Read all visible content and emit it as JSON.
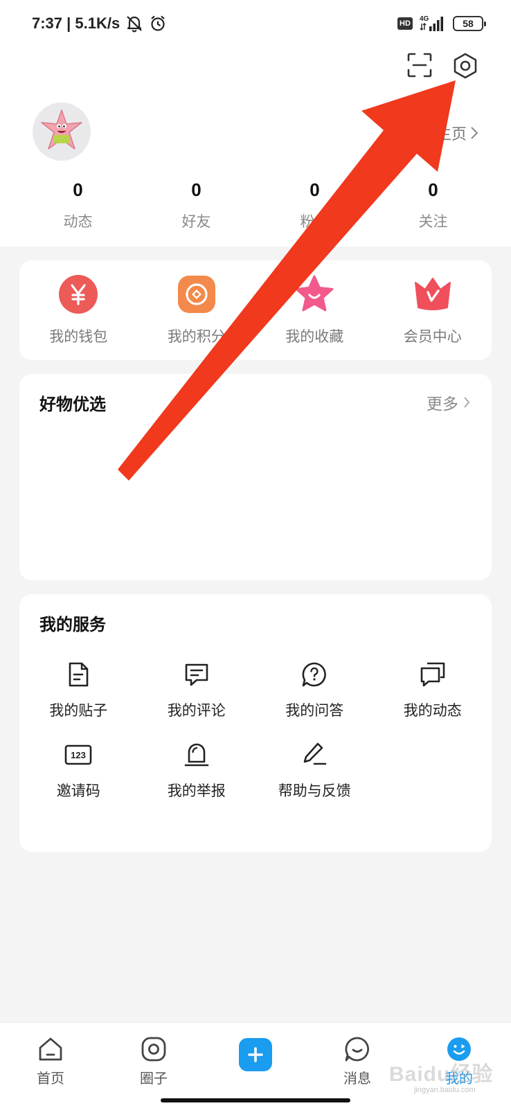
{
  "status_bar": {
    "time_speed": "7:37 | 5.1K/s",
    "hd": "HD",
    "network": "4G",
    "battery": "58",
    "icons": [
      "mute-bell-icon",
      "alarm-icon",
      "signal-icon"
    ]
  },
  "header": {
    "scan_icon": "scan-icon",
    "settings_icon": "settings-hexagon-icon"
  },
  "profile": {
    "homepage_link": "主页",
    "avatar": "patrick-star-avatar",
    "stats": [
      {
        "value": "0",
        "label": "动态"
      },
      {
        "value": "0",
        "label": "好友"
      },
      {
        "value": "0",
        "label": "粉丝"
      },
      {
        "value": "0",
        "label": "关注"
      }
    ]
  },
  "quick_actions": [
    {
      "label": "我的钱包",
      "icon": "wallet-yen-icon",
      "color": "#ec5b57"
    },
    {
      "label": "我的积分",
      "icon": "points-coin-icon",
      "color": "#f3894a"
    },
    {
      "label": "我的收藏",
      "icon": "favorite-star-icon",
      "color": "#f25a8b"
    },
    {
      "label": "会员中心",
      "icon": "vip-crown-icon",
      "color": "#f04f5c"
    }
  ],
  "goods": {
    "title": "好物优选",
    "more": "更多"
  },
  "services": {
    "title": "我的服务",
    "items": [
      {
        "label": "我的贴子",
        "icon": "document-icon"
      },
      {
        "label": "我的评论",
        "icon": "comment-icon"
      },
      {
        "label": "我的问答",
        "icon": "question-bubble-icon"
      },
      {
        "label": "我的动态",
        "icon": "dynamic-chat-icon"
      },
      {
        "label": "邀请码",
        "icon": "invite-code-123-icon"
      },
      {
        "label": "我的举报",
        "icon": "report-alarm-icon"
      },
      {
        "label": "帮助与反馈",
        "icon": "feedback-pen-icon"
      }
    ]
  },
  "bottom_nav": [
    {
      "label": "首页",
      "icon": "home-icon"
    },
    {
      "label": "圈子",
      "icon": "circle-icon"
    },
    {
      "label": "",
      "icon": "add-plus-icon"
    },
    {
      "label": "消息",
      "icon": "message-icon"
    },
    {
      "label": "我的",
      "icon": "profile-face-icon",
      "active": true
    }
  ],
  "watermark": {
    "text": "Baidu经验",
    "url": "jingyan.baidu.com"
  },
  "colors": {
    "accent": "#1a9cf0",
    "annotation_arrow": "#f0391d",
    "background": "#f4f4f5"
  }
}
